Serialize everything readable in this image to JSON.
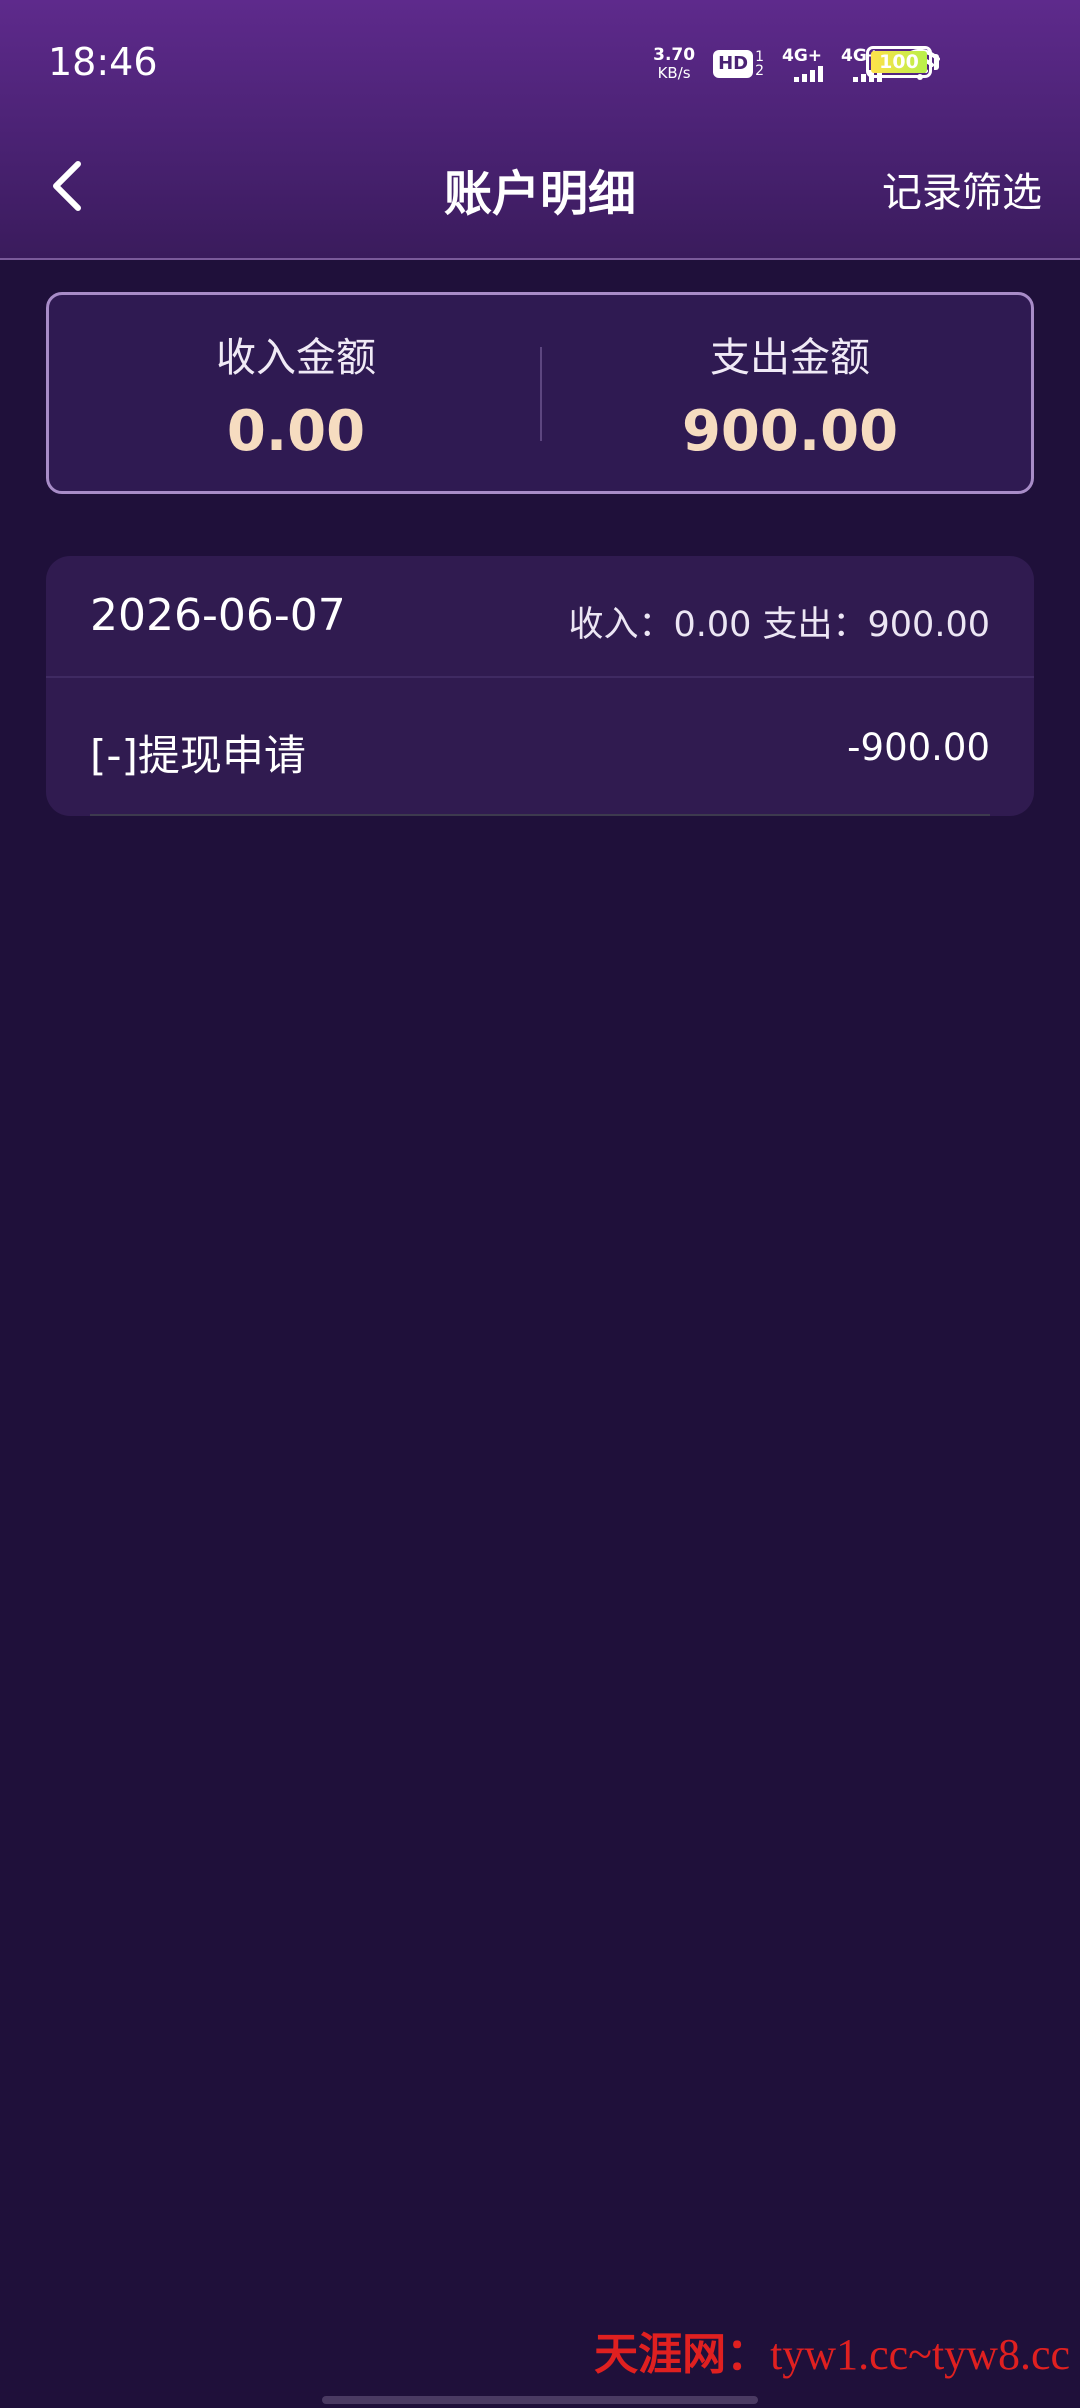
{
  "status_bar": {
    "time": "18:46",
    "net_speed_value": "3.70",
    "net_speed_unit": "KB/s",
    "hd_label": "HD",
    "hd_sub_1": "1",
    "hd_sub_2": "2",
    "sim1_network": "4G+",
    "sim2_network": "4G+",
    "battery_level": "100",
    "icons": [
      "hd-icon",
      "signal-icon",
      "wifi-icon",
      "battery-icon"
    ]
  },
  "nav": {
    "back_icon": "chevron-left-icon",
    "title": "账户明细",
    "action_label": "记录筛选"
  },
  "summary": {
    "income_label": "收入金额",
    "income_value": "0.00",
    "expense_label": "支出金额",
    "expense_value": "900.00"
  },
  "records": [
    {
      "date": "2026-06-07",
      "totals": "收入：0.00 支出：900.00",
      "items": [
        {
          "name": "[-]提现申请",
          "amount": "-900.00"
        }
      ]
    }
  ],
  "watermark": {
    "brand": "天涯网",
    "separator": "：",
    "urls": "tyw1.cc~tyw8.cc"
  },
  "colors": {
    "background": "#1f103a",
    "header_top": "#5e2a8c",
    "card": "#301b50",
    "summary_border": "#a88cc8",
    "amount_highlight": "#f6dcc0",
    "watermark": "#e02020"
  }
}
